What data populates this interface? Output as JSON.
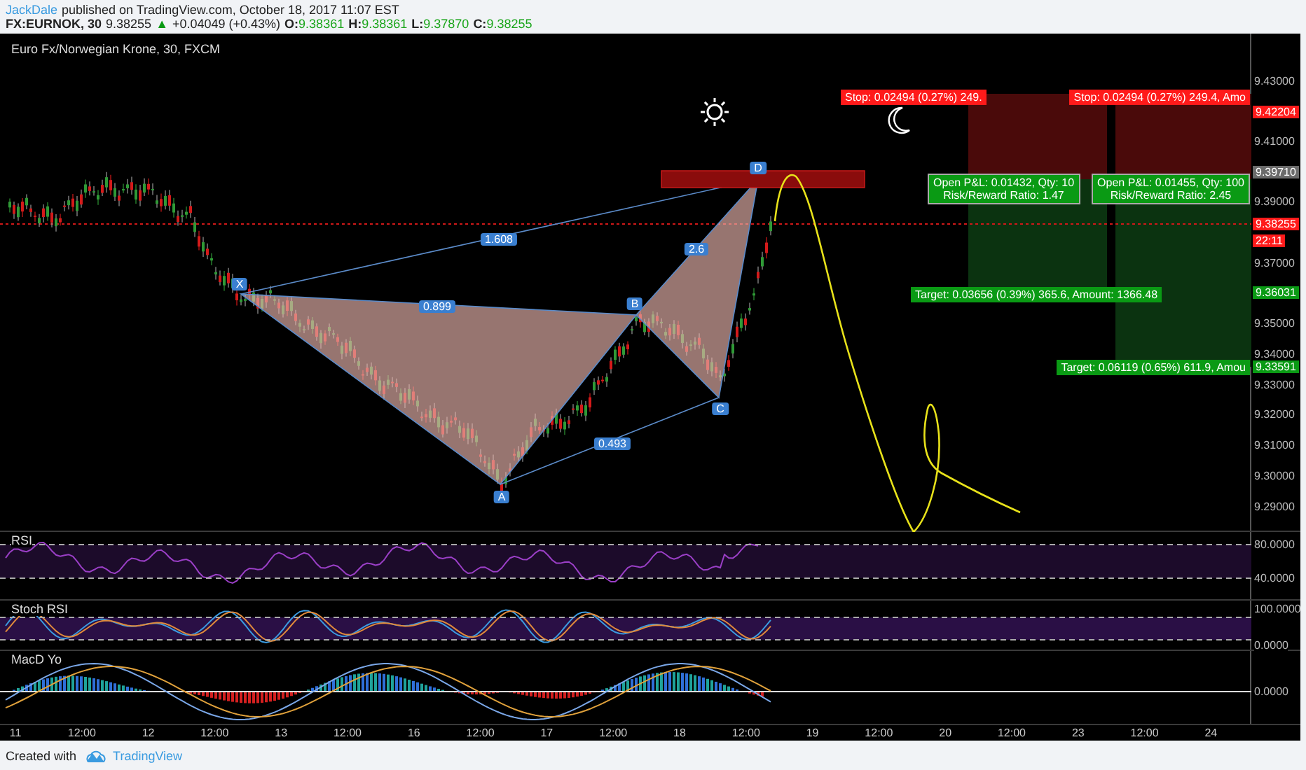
{
  "header": {
    "author": "JackDale",
    "published": "published on TradingView.com, October 18, 2017 11:07 EST",
    "symbol": "FX:EURNOK, 30",
    "last": "9.38255",
    "arrow": "▲",
    "change": "+0.04049 (+0.43%)",
    "ohlc": [
      {
        "label": "O:",
        "value": "9.38361"
      },
      {
        "label": "H:",
        "value": "9.38361"
      },
      {
        "label": "L:",
        "value": "9.37870"
      },
      {
        "label": "C:",
        "value": "9.38255"
      }
    ]
  },
  "chart": {
    "title": "Euro Fx/Norwegian Krone, 30, FXCM",
    "points": [
      "X",
      "A",
      "B",
      "C",
      "D"
    ],
    "ratios": [
      "1.608",
      "0.899",
      "2.6",
      "0.493"
    ],
    "positions": [
      {
        "stop": "Stop: 0.02494 (0.27%) 249.",
        "pnl": "Open P&L: 0.01432, Qty: 10",
        "ratio": "Risk/Reward Ratio: 1.47",
        "target": "Target: 0.03656 (0.39%) 365.6, Amount: 1366.48"
      },
      {
        "stop": "Stop: 0.02494 (0.27%) 249.4, Amo",
        "pnl": "Open P&L: 0.01455, Qty: 100",
        "ratio": "Risk/Reward Ratio: 2.45",
        "target": "Target: 0.06119 (0.65%) 611.9, Amou"
      }
    ],
    "price_axis": [
      {
        "text": "9.43000",
        "kind": "tick"
      },
      {
        "text": "9.42204",
        "kind": "tag",
        "color": "#ff1a1a"
      },
      {
        "text": "9.41000",
        "kind": "tick"
      },
      {
        "text": "9.39710",
        "kind": "tag",
        "color": "#6b6b6b"
      },
      {
        "text": "9.39000",
        "kind": "tick"
      },
      {
        "text": "9.38255",
        "kind": "tag",
        "color": "#ff1a1a"
      },
      {
        "text": "22:11",
        "kind": "tag",
        "color": "#ff1a1a"
      },
      {
        "text": "9.37000",
        "kind": "tick"
      },
      {
        "text": "9.36031",
        "kind": "tag",
        "color": "#0a9a14"
      },
      {
        "text": "9.35000",
        "kind": "tick"
      },
      {
        "text": "9.34000",
        "kind": "tick"
      },
      {
        "text": "9.33591",
        "kind": "tag",
        "color": "#0a9a14"
      },
      {
        "text": "9.33000",
        "kind": "tick"
      },
      {
        "text": "9.32000",
        "kind": "tick"
      },
      {
        "text": "9.31000",
        "kind": "tick"
      },
      {
        "text": "9.30000",
        "kind": "tick"
      },
      {
        "text": "9.29000",
        "kind": "tick"
      }
    ],
    "panes": [
      {
        "kind": "rsi",
        "title": "RSI",
        "axis": [
          "80.0000",
          "40.0000"
        ]
      },
      {
        "kind": "stoch",
        "title": "Stoch RSI",
        "axis": [
          "100.0000",
          "0.0000"
        ]
      },
      {
        "kind": "macd",
        "title": "MacD Yo",
        "axis": [
          "0.0000"
        ]
      }
    ],
    "time_axis": [
      "11",
      "12:00",
      "12",
      "12:00",
      "13",
      "12:00",
      "16",
      "12:00",
      "17",
      "12:00",
      "18",
      "12:00",
      "19",
      "12:00",
      "20",
      "12:00",
      "23",
      "12:00",
      "24"
    ]
  },
  "footer": {
    "text": "Created with",
    "brand": "TradingView"
  }
}
